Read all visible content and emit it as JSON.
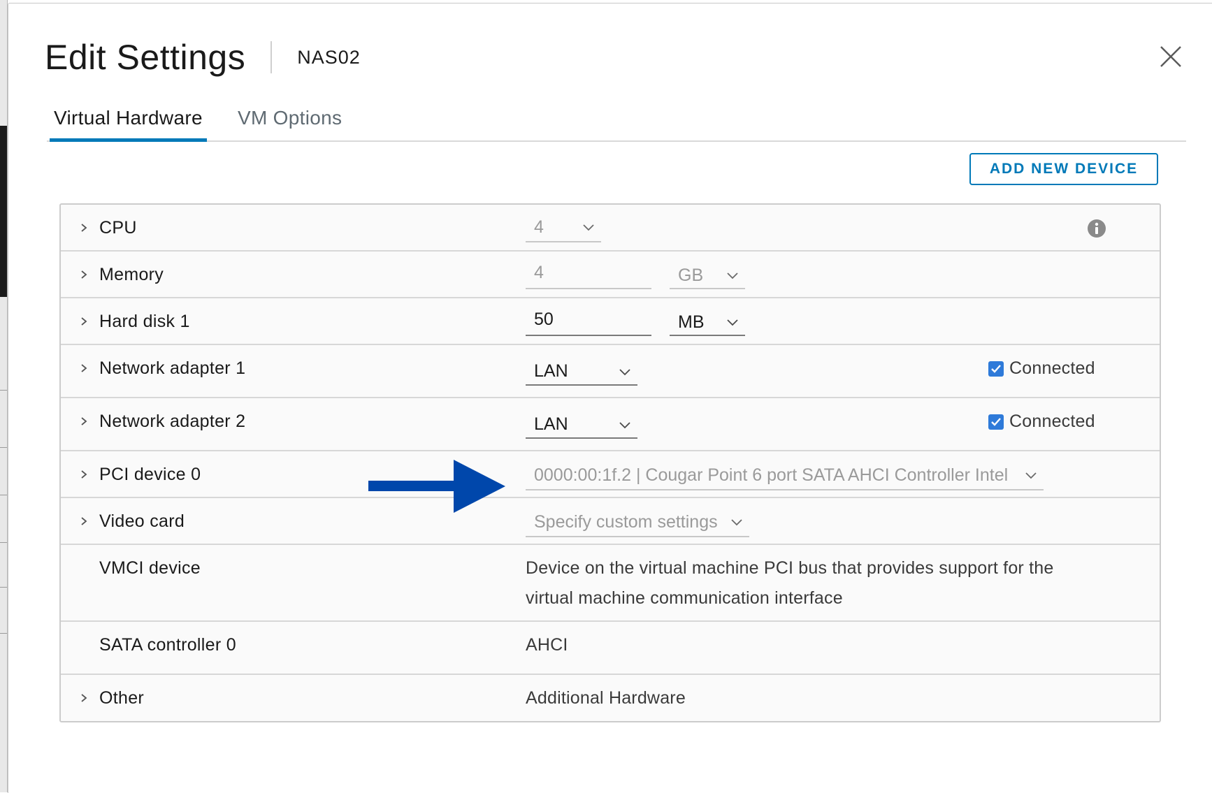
{
  "dialog": {
    "title": "Edit Settings",
    "vm_name": "NAS02",
    "close_icon": "close-icon"
  },
  "tabs": [
    {
      "label": "Virtual Hardware",
      "active": true
    },
    {
      "label": "VM Options",
      "active": false
    }
  ],
  "add_device_label": "ADD NEW DEVICE",
  "hardware": {
    "cpu": {
      "label": "CPU",
      "value": "4"
    },
    "memory": {
      "label": "Memory",
      "value": "4",
      "unit": "GB"
    },
    "disk": {
      "label": "Hard disk 1",
      "value": "50",
      "unit": "MB"
    },
    "net1": {
      "label": "Network adapter 1",
      "network": "LAN",
      "connected_label": "Connected",
      "connected": true
    },
    "net2": {
      "label": "Network adapter 2",
      "network": "LAN",
      "connected_label": "Connected",
      "connected": true
    },
    "pci": {
      "label": "PCI device 0",
      "value": "0000:00:1f.2 | Cougar Point 6 port SATA AHCI Controller Intel"
    },
    "video": {
      "label": "Video card",
      "value": "Specify custom settings"
    },
    "vmci": {
      "label": "VMCI device",
      "line1": "Device on the virtual machine PCI bus that provides support for the",
      "line2": "virtual machine communication interface"
    },
    "sata": {
      "label": "SATA controller 0",
      "value": "AHCI"
    },
    "other": {
      "label": "Other",
      "value": "Additional Hardware"
    }
  },
  "colors": {
    "accent": "#0079b8",
    "checkbox": "#2e7ad9",
    "annotation_arrow": "#0047ab"
  }
}
